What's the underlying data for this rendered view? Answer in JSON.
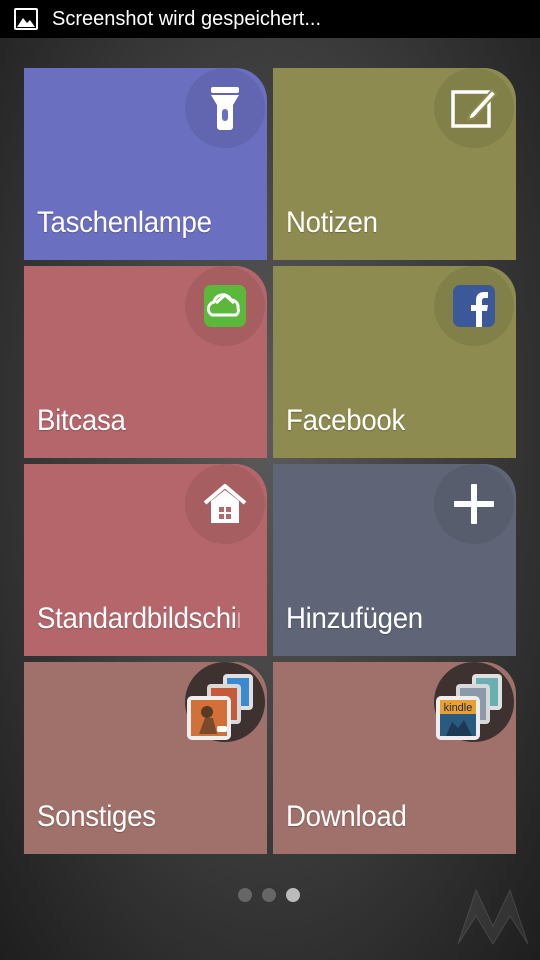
{
  "status_bar": {
    "text": "Screenshot wird gespeichert...",
    "icon": "image-icon"
  },
  "tiles": [
    {
      "label": "Taschenlampe",
      "icon": "flashlight-icon",
      "color": "#6b6fbf"
    },
    {
      "label": "Notizen",
      "icon": "notes-icon",
      "color": "#8d8b4f"
    },
    {
      "label": "Bitcasa",
      "icon": "bitcasa-icon",
      "color": "#b5666a"
    },
    {
      "label": "Facebook",
      "icon": "facebook-icon",
      "color": "#8d8b4f"
    },
    {
      "label": "Standardbildschirm",
      "icon": "home-icon",
      "color": "#b5666a"
    },
    {
      "label": "Hinzufügen",
      "icon": "plus-icon",
      "color": "#5f6577"
    },
    {
      "label": "Sonstiges",
      "icon": "apps-stack-icon",
      "color": "#a0706a"
    },
    {
      "label": "Download",
      "icon": "kindle-stack-icon",
      "color": "#a0706a"
    }
  ],
  "pager": {
    "pages": 3,
    "current": 3
  },
  "colors": {
    "blue_tile": "#6b6fbf",
    "olive_tile": "#8d8b4f",
    "red_tile": "#b5666a",
    "slate_tile": "#5f6577",
    "brown_tile": "#a0706a",
    "facebook_blue": "#3b5998",
    "bitcasa_green": "#5cb83a"
  }
}
